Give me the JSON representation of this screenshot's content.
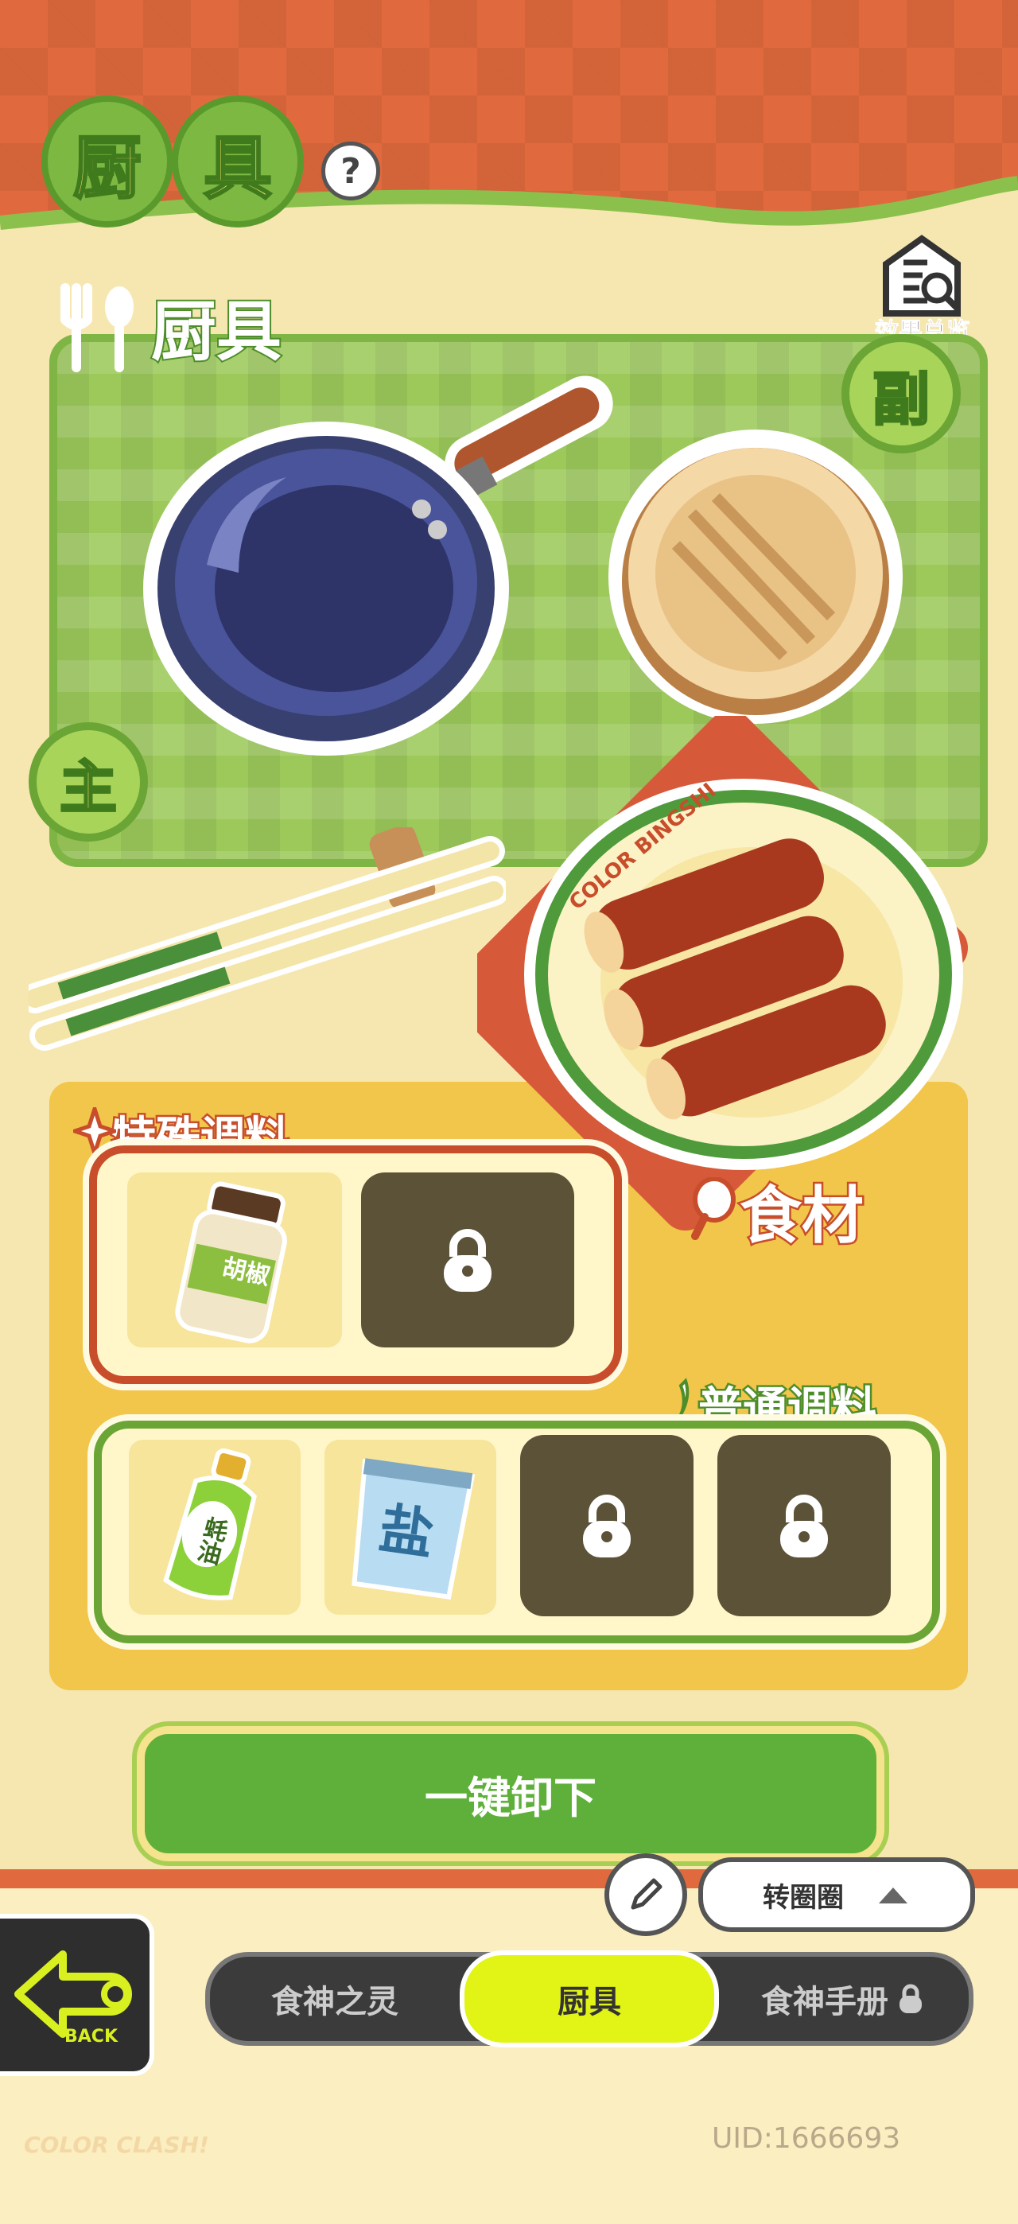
{
  "header": {
    "title_char_1": "厨",
    "title_char_2": "具",
    "help_label": "?",
    "overview_label": "效果总览"
  },
  "cookware": {
    "section_title": "厨具",
    "primary_badge": "主",
    "secondary_badge": "副"
  },
  "ingredient": {
    "label": "食材",
    "plate_text": "COLOR BINGSHI"
  },
  "special_seasoning": {
    "label": "特殊调料",
    "slots": [
      {
        "item": "胡椒",
        "locked": false
      },
      {
        "item": "",
        "locked": true
      }
    ]
  },
  "normal_seasoning": {
    "label": "普通调料",
    "slots": [
      {
        "item": "蚝油",
        "locked": false
      },
      {
        "item": "盐",
        "locked": false
      },
      {
        "item": "",
        "locked": true
      },
      {
        "item": "",
        "locked": true
      }
    ]
  },
  "actions": {
    "unload_all": "一键卸下",
    "rotate_label": "转圈圈",
    "back_label": "BACK"
  },
  "tabs": [
    {
      "label": "食神之灵",
      "active": false
    },
    {
      "label": "厨具",
      "active": true
    },
    {
      "label": "食神手册",
      "active": false,
      "locked": true
    }
  ],
  "footer": {
    "uid": "UID:1666693",
    "brand": "COLOR CLASH!"
  },
  "colors": {
    "banner": "#e06a3e",
    "green": "#6aa535",
    "accent_tab": "#e2f316",
    "background": "#f6e7b1"
  }
}
